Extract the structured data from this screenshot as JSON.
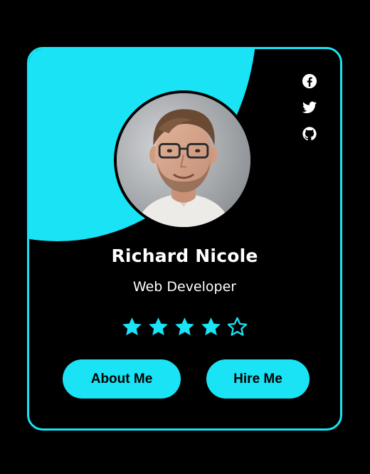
{
  "profile": {
    "name": "Richard Nicole",
    "role": "Web Developer"
  },
  "rating": {
    "value": 4,
    "max": 5
  },
  "buttons": {
    "about": "About Me",
    "hire": "Hire Me"
  },
  "social_icons": [
    "facebook-icon",
    "twitter-icon",
    "github-icon"
  ],
  "colors": {
    "accent": "#19e3f5",
    "background": "#000000",
    "text": "#ffffff"
  }
}
